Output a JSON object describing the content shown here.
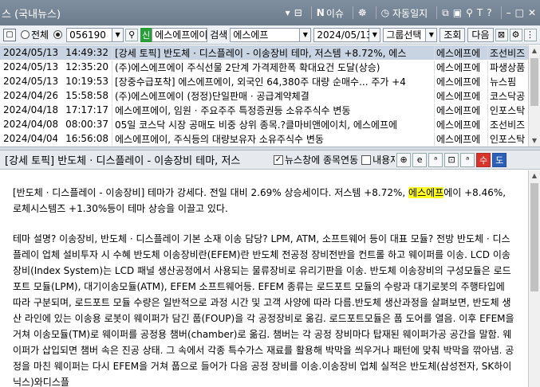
{
  "window": {
    "title": "스 (국내뉴스)",
    "menu_label": "▾",
    "n_label": "이슈",
    "auto_log_label": "자동일지",
    "help_label": "T ?",
    "win_controls": [
      "□",
      "⊞",
      "✎",
      "T",
      "?",
      "–",
      "□",
      "✕"
    ]
  },
  "toolbar": {
    "radio_all_label": "전체",
    "stock_code": "056190",
    "shin_badge": "신",
    "stock_name": "에스에프에이",
    "search_label": "검색",
    "search_value": "에스에프",
    "date_value": "2024/05/13",
    "group_label": "그룹선택",
    "query_button": "조회",
    "next_button": "다음"
  },
  "news_list": [
    {
      "date": "2024/05/13",
      "time": "14:49:32",
      "title": "[강세 토픽] 반도체 · 디스플레이 - 이송장비 테마, 저스템 +8.72%, 에스",
      "source": "에스에프에",
      "category": "조선비즈",
      "selected": true
    },
    {
      "date": "2024/05/13",
      "time": "12:35:20",
      "title": "(주)에스에프에이 주식선물 2단계 가격제한폭 확대요건 도달(상승)",
      "source": "에스에프에",
      "category": "파생상품",
      "selected": false
    },
    {
      "date": "2024/05/13",
      "time": "10:19:53",
      "title": "[장중수급포착] 에스에프에이, 외국인 64,380주 대량 순매수... 주가 +4",
      "source": "에스에프에",
      "category": "뉴스핌",
      "selected": false
    },
    {
      "date": "2024/04/26",
      "time": "15:58:58",
      "title": "(주)에스에프에이 (정정)단일판매 · 공급계약체결",
      "source": "에스에프에",
      "category": "코스닥공",
      "selected": false
    },
    {
      "date": "2024/04/18",
      "time": "17:17:17",
      "title": "에스에프에이, 임원 · 주요주주 특정증권등 소유주식수 변동",
      "source": "에스에프에",
      "category": "인포스탁",
      "selected": false
    },
    {
      "date": "2024/04/08",
      "time": "08:00:37",
      "title": "05일 코스닥 시장 공매도 비중 상위 종목.?클마비앤에이치, 에스에프에",
      "source": "에스에프에",
      "category": "조선비즈",
      "selected": false
    },
    {
      "date": "2024/04/04",
      "time": "16:56:08",
      "title": "에스에프에이, 주식등의 대량보유자 소유주식수 변동",
      "source": "에스에프에",
      "category": "인포스탁",
      "selected": false
    }
  ],
  "detail": {
    "title": "[강세 토픽] 반도체 · 디스플레이 - 이송장비 테마, 저스",
    "link_label": "뉴스창에 종목연동",
    "content_auto_label": "내용자동",
    "para1_a": "[반도체 · 디스플레이 - 이송장비] 테마가 강세다. 전일 대비 2.69% 상승세이다. 저스템 +8.72%, ",
    "para1_hl": "에스에프",
    "para1_b": "에이 +8.46%, 로체시스템즈 +1.30%등이 테마 상승을 이끌고 있다.",
    "para2": "테마 설명? 이송장비, 반도체 · 디스플레이 기본 소재 이송 담당? LPM, ATM, 소프트웨어 등이 대표 모듈? 전방 반도체 · 디스플레이 업체 설비투자 시 수혜 반도체 이송장비란(EFEM)란 반도체 전공정 장비전반을 컨트롤 하고 웨이퍼를 이송. LCD 이송장비(Index System)는 LCD 패널 생산공정에서 사용되는 물류장비로 유리기판을 이송. 반도체 이송장비의 구성모듈은 로드포트 모듈(LPM), 대기이송모듈(ATM), EFEM 소프트웨어등. EFEM 종류는 로드포트 모듈의 수량과 대기로봇의 주행타입에 따라 구분되며, 로드포트 모듈 수량은 일반적으로 과정 시간 및 고객 사양에 따라 다름.반도체 생산과정을 살펴보면, 반도체 생산 라인에 있는 이송용 로봇이 웨이퍼가 담긴 풉(FOUP)을 각 공정장비로 옮김. 로드포트모듈은 풉 도어를 열음. 이후 EFEM을 거쳐 이송모듈(TM)로 웨이퍼를 공정용 챔버(chamber)로 옮김. 챔버는 각 공정 장비마다 탑재된 웨이퍼가공 공간을 말함. 웨이퍼가 삽입되면 챔버 속은 진공 상태. 그 속에서 각종 특수가스 재료를 활용해 박막을 씌우거나 패턴에 맞춰 박막을 깎아냄. 공정을 마친 웨이퍼는 다시 EFEM을 거쳐 풉으로 들어가 다음 공정 장비를 이송.이송장비 업체 실적은 반도체(삼성전자, SK하이닉스)와디스플"
  },
  "colors": {
    "titlebar": "#7a8a9a",
    "selected_row": "#c8d4e2",
    "highlight": "#ffff26",
    "shin_badge": "#2a9d3a"
  }
}
